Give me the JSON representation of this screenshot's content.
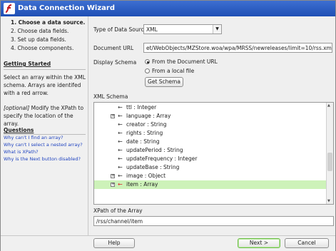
{
  "window": {
    "title": "Data Connection Wizard"
  },
  "sidebar": {
    "steps": [
      {
        "label": "1. Choose a data source."
      },
      {
        "label": "2. Choose data fields."
      },
      {
        "label": "3. Set up data fields."
      },
      {
        "label": "4. Choose components."
      }
    ],
    "getting_started": {
      "heading": "Getting Started",
      "text_1": "Select an array within the XML schema. Arrays are identifed with a red arrow.",
      "optional_tag": "[optional]",
      "text_2": " Modify the XPath to specify the location of the array."
    },
    "questions": {
      "heading": "Questions",
      "links": [
        "Why can't I find an array?",
        "Why can't I select a nested array?",
        "What is XPath?",
        "Why is the Next button disabled?"
      ]
    }
  },
  "main": {
    "type_label": "Type of Data Source",
    "type_value": "XML",
    "doc_url_label": "Document URL",
    "doc_url_value": "et/WebObjects/MZStore.woa/wpa/MRSS/newreleases/limit=10/rss.xml",
    "display_schema_label": "Display Schema",
    "radio_from_doc": "From the Document URL",
    "radio_from_local": "From a local file",
    "get_schema_button": "Get Schema",
    "xml_schema_label": "XML Schema",
    "tree": [
      {
        "label": "ttl : Integer",
        "expandable": false
      },
      {
        "label": "language : Array",
        "expandable": true
      },
      {
        "label": "creator : String",
        "expandable": false
      },
      {
        "label": "rights : String",
        "expandable": false
      },
      {
        "label": "date : String",
        "expandable": false
      },
      {
        "label": "updatePeriod : String",
        "expandable": false
      },
      {
        "label": "updateFrequency : Integer",
        "expandable": false
      },
      {
        "label": "updateBase : String",
        "expandable": false
      },
      {
        "label": "image : Object",
        "expandable": true
      },
      {
        "label": "item : Array",
        "expandable": true,
        "selected": true
      }
    ],
    "xpath_label": "XPath of the Array",
    "xpath_value": "/rss/channel/item"
  },
  "footer": {
    "help": "Help",
    "next": "Next >",
    "cancel": "Cancel"
  },
  "colors": {
    "titlebar": "#2a5cc4",
    "selected_row": "#cdf2b9",
    "array_arrow": "#dd2222",
    "link": "#2044c0"
  }
}
